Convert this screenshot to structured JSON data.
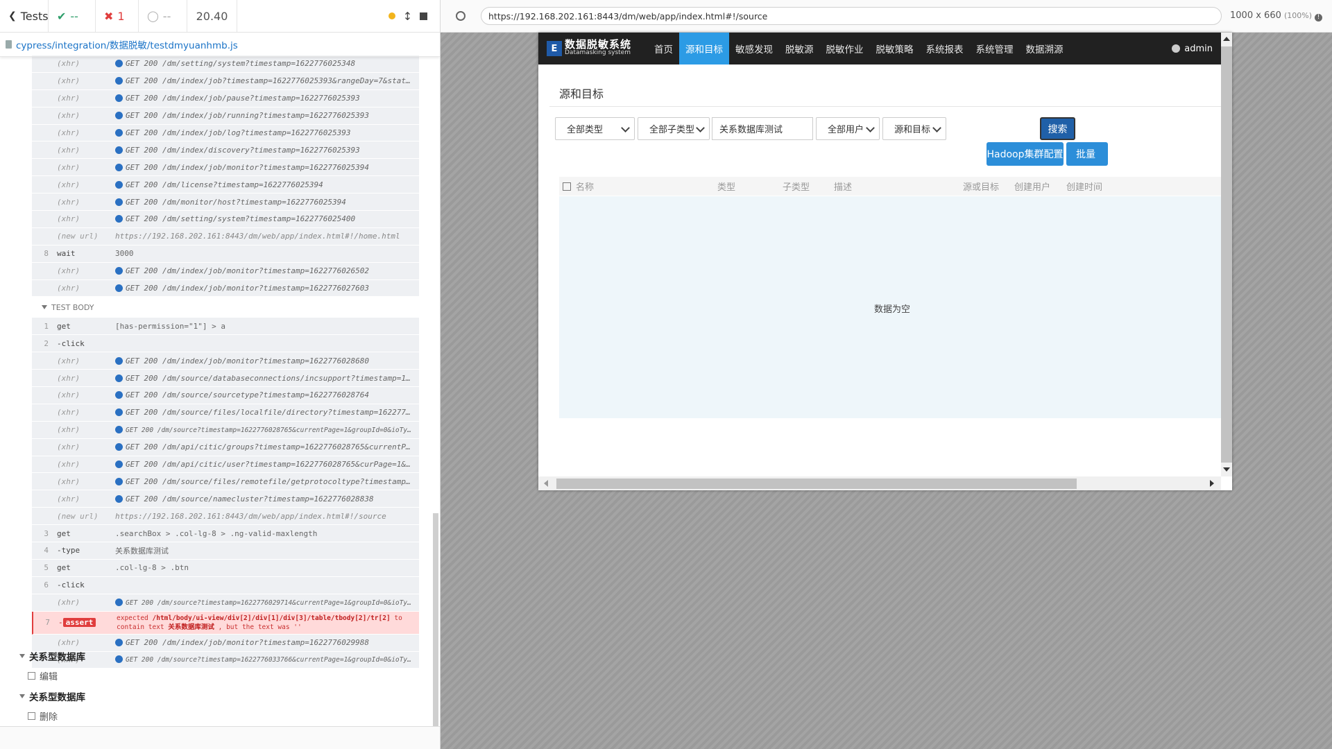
{
  "reporter": {
    "toolbar": {
      "back_label": "Tests",
      "passed": "--",
      "failed": "1",
      "pending": "--",
      "duration": "20.40"
    },
    "spec_path": "cypress/integration/数据脱敏/testdmyuanhmb.js",
    "hook_commands": [
      {
        "num": "",
        "name": "(xhr)",
        "msg": "GET 200 /dm/setting/system?timestamp=1622776025348",
        "xhr": true
      },
      {
        "num": "",
        "name": "(xhr)",
        "msg": "GET 200 /dm/index/job?timestamp=1622776025393&rangeDay=7&statu...",
        "xhr": true
      },
      {
        "num": "",
        "name": "(xhr)",
        "msg": "GET 200 /dm/index/job/pause?timestamp=1622776025393",
        "xhr": true
      },
      {
        "num": "",
        "name": "(xhr)",
        "msg": "GET 200 /dm/index/job/running?timestamp=1622776025393",
        "xhr": true
      },
      {
        "num": "",
        "name": "(xhr)",
        "msg": "GET 200 /dm/index/job/log?timestamp=1622776025393",
        "xhr": true
      },
      {
        "num": "",
        "name": "(xhr)",
        "msg": "GET 200 /dm/index/discovery?timestamp=1622776025393",
        "xhr": true
      },
      {
        "num": "",
        "name": "(xhr)",
        "msg": "GET 200 /dm/index/job/monitor?timestamp=1622776025394",
        "xhr": true
      },
      {
        "num": "",
        "name": "(xhr)",
        "msg": "GET 200 /dm/license?timestamp=1622776025394",
        "xhr": true
      },
      {
        "num": "",
        "name": "(xhr)",
        "msg": "GET 200 /dm/monitor/host?timestamp=1622776025394",
        "xhr": true
      },
      {
        "num": "",
        "name": "(xhr)",
        "msg": "GET 200 /dm/setting/system?timestamp=1622776025400",
        "xhr": true
      },
      {
        "num": "",
        "name": "(new url)",
        "msg": "https://192.168.202.161:8443/dm/web/app/index.html#!/home.html",
        "xhr": false
      },
      {
        "num": "8",
        "name": "wait",
        "msg": "3000",
        "xhr": false
      },
      {
        "num": "",
        "name": "(xhr)",
        "msg": "GET 200 /dm/index/job/monitor?timestamp=1622776026502",
        "xhr": true
      },
      {
        "num": "",
        "name": "(xhr)",
        "msg": "GET 200 /dm/index/job/monitor?timestamp=1622776027603",
        "xhr": true
      }
    ],
    "test_body_label": "TEST BODY",
    "body_commands": [
      {
        "num": "1",
        "name": "get",
        "msg": "[has-permission=\"1\"] > a",
        "xhr": false
      },
      {
        "num": "2",
        "name": "-click",
        "msg": "",
        "xhr": false
      },
      {
        "num": "",
        "name": "(xhr)",
        "msg": "GET 200 /dm/index/job/monitor?timestamp=1622776028680",
        "xhr": true
      },
      {
        "num": "",
        "name": "(xhr)",
        "msg": "GET 200 /dm/source/databaseconnections/incsupport?timestamp=16...",
        "xhr": true
      },
      {
        "num": "",
        "name": "(xhr)",
        "msg": "GET 200 /dm/source/sourcetype?timestamp=1622776028764",
        "xhr": true
      },
      {
        "num": "",
        "name": "(xhr)",
        "msg": "GET 200 /dm/source/files/localfile/directory?timestamp=1622776...",
        "xhr": true
      },
      {
        "num": "",
        "name": "(xhr)",
        "msg": "GET 200 /dm/source?timestamp=1622776028765&currentPage=1&groupId=0&ioType...",
        "xhr": true,
        "small": true
      },
      {
        "num": "",
        "name": "(xhr)",
        "msg": "GET 200 /dm/api/citic/groups?timestamp=1622776028765&currentPa...",
        "xhr": true
      },
      {
        "num": "",
        "name": "(xhr)",
        "msg": "GET 200 /dm/api/citic/user?timestamp=1622776028765&curPage=1&p...",
        "xhr": true
      },
      {
        "num": "",
        "name": "(xhr)",
        "msg": "GET 200 /dm/source/files/remotefile/getprotocoltype?timestamp=...",
        "xhr": true
      },
      {
        "num": "",
        "name": "(xhr)",
        "msg": "GET 200 /dm/source/namecluster?timestamp=1622776028838",
        "xhr": true
      },
      {
        "num": "",
        "name": "(new url)",
        "msg": "https://192.168.202.161:8443/dm/web/app/index.html#!/source",
        "xhr": false
      },
      {
        "num": "3",
        "name": "get",
        "msg": ".searchBox > .col-lg-8 > .ng-valid-maxlength",
        "xhr": false
      },
      {
        "num": "4",
        "name": "-type",
        "msg": "关系数据库测试",
        "xhr": false
      },
      {
        "num": "5",
        "name": "get",
        "msg": ".col-lg-8 > .btn",
        "xhr": false
      },
      {
        "num": "6",
        "name": "-click",
        "msg": "",
        "xhr": false
      },
      {
        "num": "",
        "name": "(xhr)",
        "msg": "GET 200 /dm/source?timestamp=1622776029714&currentPage=1&groupId=0&ioType...",
        "xhr": true,
        "small": true
      }
    ],
    "error_row": {
      "num": "7",
      "badge": "assert",
      "line1_pre": "expected",
      "line1_path": "/html/body/ui-view/div[2]/div[1]/div[3]/table/tbody[2]/tr[2]",
      "line1_post": "to",
      "line2_pre": "contain text",
      "line2_text": "关系数据库测试",
      "line2_post": ", but the text was ''"
    },
    "after_commands": [
      {
        "num": "",
        "name": "(xhr)",
        "msg": "GET 200 /dm/index/job/monitor?timestamp=1622776029988",
        "xhr": true
      },
      {
        "num": "",
        "name": "(xhr)",
        "msg": "GET 200 /dm/source?timestamp=1622776033766&currentPage=1&groupId=0&ioType...",
        "xhr": true,
        "small": true
      }
    ],
    "suites": [
      {
        "title": "关系型数据库",
        "test": "编辑"
      },
      {
        "title": "关系型数据库",
        "test": "删除"
      }
    ]
  },
  "aut": {
    "url": "https://192.168.202.161:8443/dm/web/app/index.html#!/source",
    "viewport": "1000 x 660",
    "viewport_pct": "(100%)",
    "app": {
      "logo_cn": "数据脱敏系统",
      "logo_en": "Datamasking system",
      "logo_mark": "E",
      "nav": [
        "首页",
        "源和目标",
        "敏感发现",
        "脱敏源",
        "脱敏作业",
        "脱敏策略",
        "系统报表",
        "系统管理",
        "数据溯源"
      ],
      "active_nav": "源和目标",
      "user": "admin",
      "page_title": "源和目标",
      "filters": {
        "type": "全部类型",
        "subtype": "全部子类型",
        "keyword": "关系数据库测试",
        "user": "全部用户",
        "io": "源和目标"
      },
      "search_label": "搜索",
      "hadoop_label": "Hadoop集群配置",
      "batch_label": "批量",
      "columns": [
        "名称",
        "类型",
        "子类型",
        "描述",
        "源或目标",
        "创建用户",
        "创建时间"
      ],
      "empty_text": "数据为空"
    }
  },
  "colors": {
    "pass": "#2e9e6a",
    "fail": "#e03d3d",
    "nav_bg": "#212121",
    "nav_active": "#2c9be5",
    "btn_blue": "#2c8ed9",
    "link_blue": "#1a73c7"
  }
}
